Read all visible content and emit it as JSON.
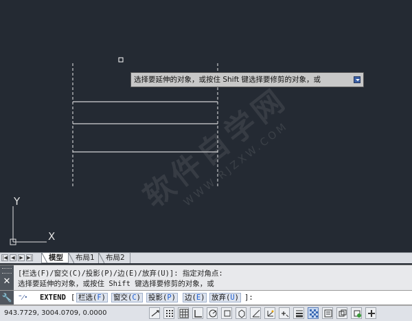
{
  "tooltip": {
    "text": "选择要延伸的对象，或按住 Shift 键选择要修剪的对象，或",
    "expand_icon": "dropdown-arrow-icon"
  },
  "watermark": {
    "text": "软件自学网",
    "url": "WWW.RJZXW.COM"
  },
  "ucs": {
    "x_label": "X",
    "y_label": "Y"
  },
  "layout_tabs": {
    "nav": [
      "|◀",
      "◀",
      "▶",
      "▶|"
    ],
    "items": [
      {
        "label": "模型",
        "active": true
      },
      {
        "label": "布局1",
        "active": false
      },
      {
        "label": "布局2",
        "active": false
      }
    ]
  },
  "command_history": {
    "lines": [
      "[栏选(F)/窗交(C)/投影(P)/边(E)/放弃(U)]: 指定对角点:",
      "选择要延伸的对象，或按住 Shift 键选择要修剪的对象，或"
    ]
  },
  "command_line": {
    "prompt_icon": "⁻⁄·",
    "command": "EXTEND",
    "open_bracket": "[",
    "close_bracket": "]:",
    "options": [
      {
        "label": "栏选",
        "key": "F"
      },
      {
        "label": "窗交",
        "key": "C"
      },
      {
        "label": "投影",
        "key": "P"
      },
      {
        "label": "边",
        "key": "E"
      },
      {
        "label": "放弃",
        "key": "U"
      }
    ]
  },
  "status_bar": {
    "coordinates": "943.7729,   3004.0709,  0.0000",
    "toggles": [
      {
        "name": "infer-constraints",
        "on": false
      },
      {
        "name": "snap-mode",
        "on": false
      },
      {
        "name": "grid-display",
        "on": false
      },
      {
        "name": "ortho-mode",
        "on": false
      },
      {
        "name": "polar-tracking",
        "on": false
      },
      {
        "name": "object-snap",
        "on": false
      },
      {
        "name": "3d-object-snap",
        "on": false
      },
      {
        "name": "object-snap-tracking",
        "on": false
      },
      {
        "name": "dynamic-ucs",
        "on": false
      },
      {
        "name": "dynamic-input",
        "on": false
      },
      {
        "name": "lineweight",
        "on": false
      },
      {
        "name": "transparency",
        "on": true
      },
      {
        "name": "quick-properties",
        "on": false
      },
      {
        "name": "selection-cycling",
        "on": false
      },
      {
        "name": "annotation-monitor",
        "on": false
      }
    ]
  }
}
